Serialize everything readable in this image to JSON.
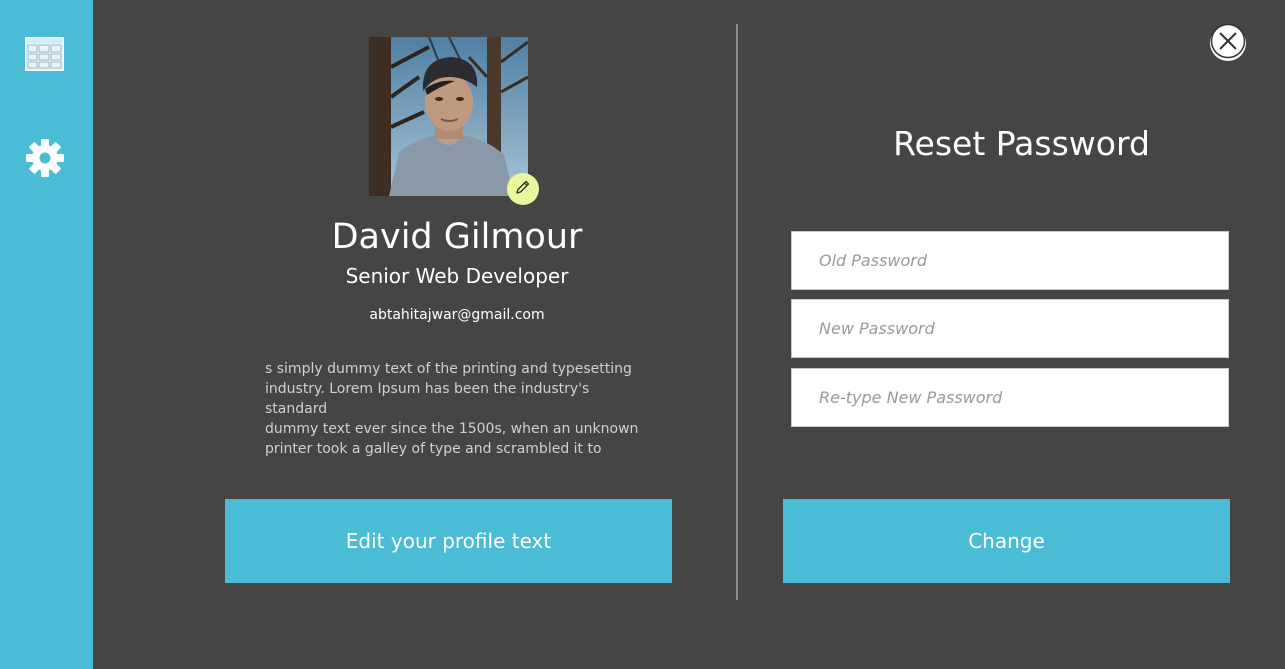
{
  "sidebar": {
    "items": [
      {
        "icon": "dashboard-icon"
      },
      {
        "icon": "gear-icon"
      }
    ],
    "color": "#4bbcd6"
  },
  "profile": {
    "name": "David Gilmour",
    "role": "Senior Web Developer",
    "email": "abtahitajwar@gmail.com",
    "bio": "s simply dummy text of the printing and typesetting\nindustry. Lorem Ipsum has been the industry's standard\ndummy text ever since the 1500s, when an unknown\nprinter took a galley of type and scrambled it to make\na type specimen book. It has survived not only five",
    "edit_button_label": "Edit your profile text",
    "edit_avatar_icon": "pencil-icon"
  },
  "reset_password": {
    "title": "Reset Password",
    "old_password_placeholder": "Old Password",
    "new_password_placeholder": "New Password",
    "retype_password_placeholder": "Re-type New Password",
    "change_button_label": "Change",
    "close_icon": "close-icon"
  },
  "colors": {
    "background": "#454545",
    "accent": "#4bbcd6",
    "avatar_edit_badge": "#eaf79a"
  }
}
